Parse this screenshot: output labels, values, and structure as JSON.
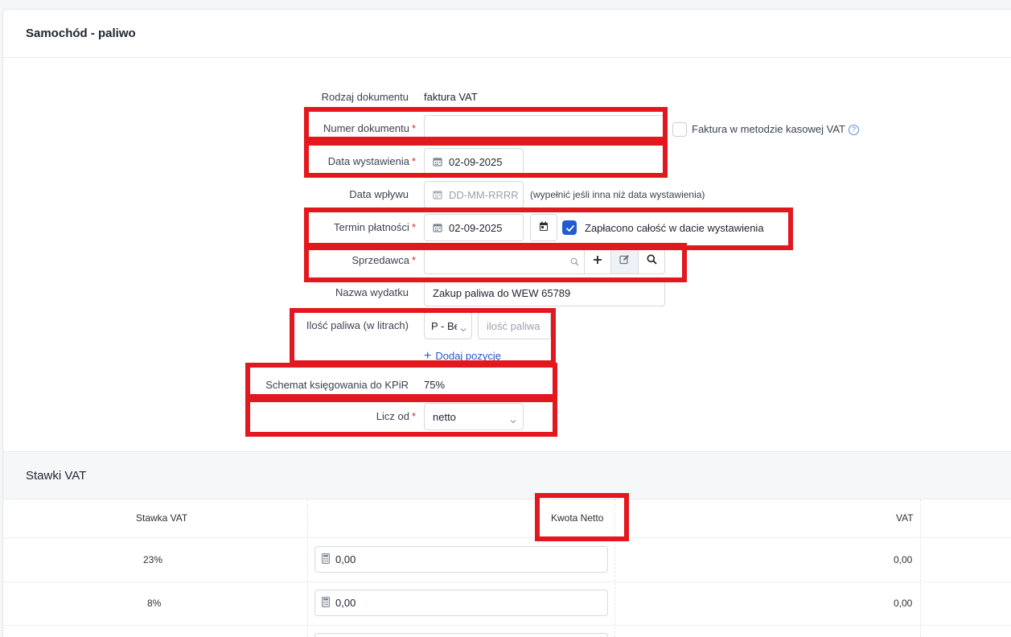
{
  "header": {
    "title": "Samochód - paliwo"
  },
  "form": {
    "doc_type_label": "Rodzaj dokumentu",
    "doc_type_value": "faktura VAT",
    "doc_number_label": "Numer dokumentu",
    "doc_number_value": "",
    "cash_vat_label": "Faktura w metodzie kasowej VAT",
    "cash_vat_help": "?",
    "issue_date_label": "Data wystawienia",
    "issue_date_value": "02-09-2025",
    "receipt_date_label": "Data wpływu",
    "receipt_date_placeholder": "DD-MM-RRRR",
    "receipt_date_hint": "(wypełnić jeśli inna niż data wystawienia)",
    "due_date_label": "Termin płatności",
    "due_date_value": "02-09-2025",
    "paid_label": "Zapłacono całość w dacie wystawienia",
    "paid_checked": true,
    "seller_label": "Sprzedawca",
    "seller_value": "",
    "expense_name_label": "Nazwa wydatku",
    "expense_name_value": "Zakup paliwa do WEW 65789",
    "fuel_qty_label": "Ilość paliwa (w litrach)",
    "fuel_type_value": "P - Be",
    "fuel_qty_placeholder": "ilość paliwa",
    "add_position_label": "Dodaj pozycję",
    "add_position_icon": "+",
    "kpir_label": "Schemat księgowania do KPiR",
    "kpir_value": "75%",
    "calc_from_label": "Licz od",
    "calc_from_value": "netto",
    "required_mark": "*"
  },
  "vat_section": {
    "title": "Stawki VAT",
    "columns": [
      "Stawka VAT",
      "Kwota Netto",
      "VAT"
    ],
    "rows": [
      {
        "rate": "23%",
        "net": "0,00",
        "vat": "0,00"
      },
      {
        "rate": "8%",
        "net": "0,00",
        "vat": "0,00"
      }
    ]
  },
  "colors": {
    "accent": "#1f5bd1",
    "required": "#d42b2b",
    "highlight": "#e3181f"
  },
  "icons": [
    "calendar-icon",
    "calendar-today-icon",
    "check-icon",
    "search-icon",
    "plus-icon",
    "edit-icon",
    "chevron-down-icon",
    "calculator-icon",
    "help-icon"
  ]
}
